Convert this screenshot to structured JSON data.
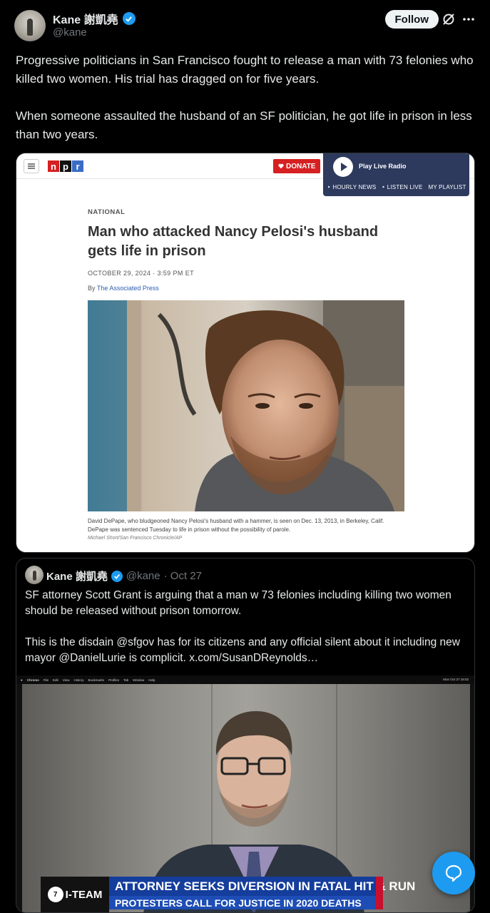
{
  "header": {
    "name": "Kane 謝凱堯",
    "handle": "@kane",
    "follow_label": "Follow"
  },
  "tweet": {
    "paragraphs": [
      "Progressive politicians in San Francisco fought to release a man with 73 felonies who killed two women. His trial has dragged on for five years.",
      "When someone assaulted the husband of an SF politician, he got life in prison in less than two years."
    ]
  },
  "npr": {
    "logo_letters": [
      "n",
      "p",
      "r"
    ],
    "donate_label": "DONATE",
    "play_label": "Play Live Radio",
    "links": [
      "‣ HOURLY NEWS",
      "‣ LISTEN LIVE",
      "MY PLAYLIST"
    ],
    "section": "NATIONAL",
    "headline": "Man who attacked Nancy Pelosi's husband gets life in prison",
    "dateline": "OCTOBER 29, 2024 · 3:59 PM ET",
    "byline_prefix": "By ",
    "byline_source": "The Associated Press",
    "caption": "David DePape, who bludgeoned Nancy Pelosi's husband with a hammer, is seen on Dec. 13, 2013, in Berkeley, Calif. DePape was sentenced Tuesday to life in prison without the possibility of parole.",
    "credit": "Michael Short/San Francisco Chronicle/AP"
  },
  "quote": {
    "name": "Kane 謝凱堯",
    "handle": "@kane",
    "date": "· Oct 27",
    "paragraphs": [
      "SF attorney Scott Grant is arguing that a man w 73 felonies including killing two women should be released without prison tomorrow.",
      "This is the disdain @sfgov has for its citizens and any official silent about it including new mayor @DanielLurie is complicit.  x.com/SusanDReynolds…"
    ]
  },
  "video": {
    "menubar": [
      "Chrome",
      "File",
      "Edit",
      "View",
      "History",
      "Bookmarks",
      "Profiles",
      "Tab",
      "Window",
      "Help"
    ],
    "menubar_clock": "Mon Oct 27  16:02",
    "chyron_logo": "I-TEAM",
    "chyron_line1": "ATTORNEY SEEKS DIVERSION IN FATAL HIT & RUN",
    "chyron_line2": "PROTESTERS CALL FOR JUSTICE IN 2020 DEATHS"
  },
  "icons": {
    "verified": "verified-badge-icon",
    "grok": "grok-icon",
    "more": "more-icon",
    "chat": "chat-bubble-icon"
  },
  "colors": {
    "accent": "#1d9bf0",
    "npr_red": "#d62021",
    "npr_blue": "#2d3a5e",
    "chyron_blue": "#143d9c"
  }
}
